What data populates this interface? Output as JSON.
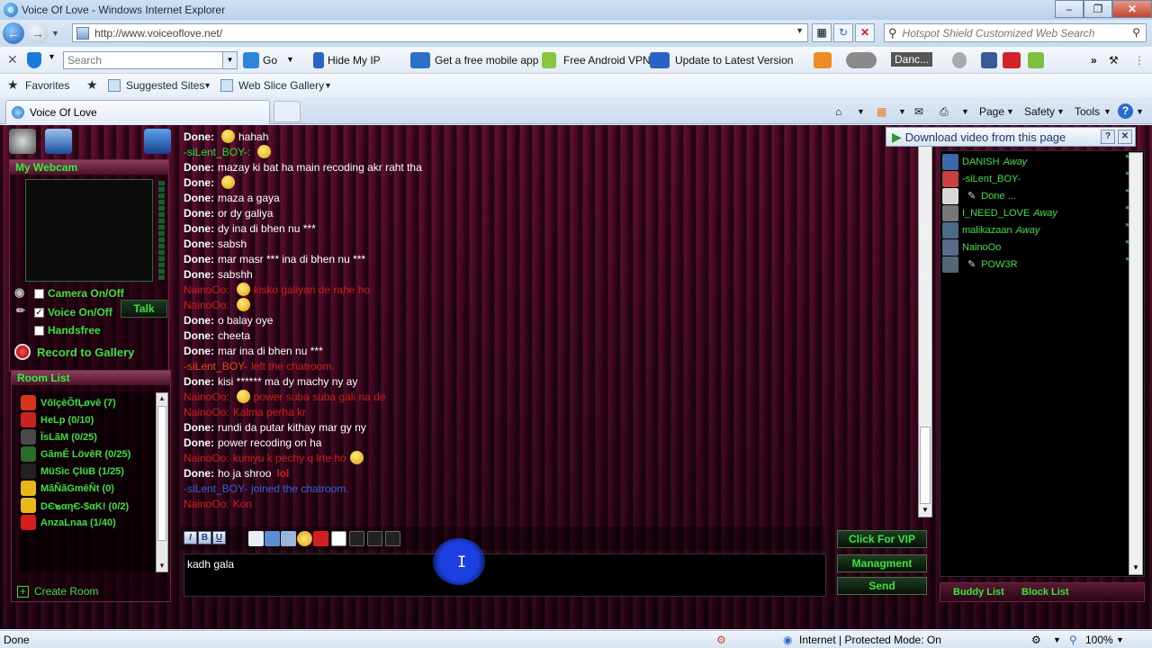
{
  "browser": {
    "title": "Voice Of Love - Windows Internet Explorer",
    "url": "http://www.voiceoflove.net/",
    "search_placeholder": "Hotspot Shield Customized Web Search",
    "tab_title": "Voice Of Love",
    "status_left": "Done",
    "status_zone": "Internet | Protected Mode: On",
    "zoom": "100%"
  },
  "toolbar": {
    "search_placeholder": "Search",
    "go": "Go",
    "hide_ip": "Hide My IP",
    "mobile_app": "Get a free mobile app",
    "android_vpn": "Free Android VPN",
    "update": "Update to Latest Version",
    "media": "Danc..."
  },
  "favorites": {
    "favorites": "Favorites",
    "suggested": "Suggested Sites",
    "web_slice": "Web Slice Gallery"
  },
  "commands": {
    "page": "Page",
    "safety": "Safety",
    "tools": "Tools"
  },
  "left_panel": {
    "webcam_title": "My Webcam",
    "camera": "Camera On/Off",
    "voice": "Voice On/Off",
    "handsfree": "Handsfree",
    "talk": "Talk",
    "record": "Record to Gallery",
    "room_list_title": "Room List",
    "create_room": "Create Room",
    "rooms": [
      {
        "name": "VôïçèÕfĻøvê (7)",
        "color": "#d9341e"
      },
      {
        "name": "HeLp (0/10)",
        "color": "#c92222"
      },
      {
        "name": "ÏsLãM (0/25)",
        "color": "#4a4a4a"
      },
      {
        "name": "GãmÉ LövêR (0/25)",
        "color": "#2a6d2a"
      },
      {
        "name": "MüSìc ÇlüB (1/25)",
        "color": "#222222"
      },
      {
        "name": "MãÑãGmêÑt (0)",
        "color": "#e8b81a"
      },
      {
        "name": "DЄ๒αηЄ-$αK! (0/2)",
        "color": "#e8b81a"
      },
      {
        "name": "AnzaLnaa (1/40)",
        "color": "#d41f1f"
      }
    ]
  },
  "chat": {
    "messages": [
      {
        "user": "Done:",
        "type": "done",
        "text": "hahah",
        "emote": true
      },
      {
        "user": "-siLent_BOY-:",
        "type": "green",
        "text": "",
        "emote": true
      },
      {
        "user": "Done:",
        "type": "done",
        "text": "mazay ki bat ha main recoding akr raht tha"
      },
      {
        "user": "Done:",
        "type": "done",
        "text": "",
        "emote": true
      },
      {
        "user": "Done:",
        "type": "done",
        "text": "maza a gaya"
      },
      {
        "user": "Done:",
        "type": "done",
        "text": "or dy galiya"
      },
      {
        "user": "Done:",
        "type": "done",
        "text": "dy ina di bhen nu ***"
      },
      {
        "user": "Done:",
        "type": "done",
        "text": "sabsh"
      },
      {
        "user": "Done:",
        "type": "done",
        "text": "mar masr *** ina di bhen nu ***"
      },
      {
        "user": "Done:",
        "type": "done",
        "text": "sabshh"
      },
      {
        "user": "NainoOo:",
        "type": "red",
        "text": "kisko galiyan de rahe ho",
        "emote": true
      },
      {
        "user": "NainoOo:",
        "type": "red",
        "text": "",
        "emote": true
      },
      {
        "user": "Done:",
        "type": "done",
        "text": "o balay oye"
      },
      {
        "user": "Done:",
        "type": "done",
        "text": "cheeta"
      },
      {
        "user": "Done:",
        "type": "done",
        "text": "mar ina di bhen nu ***"
      },
      {
        "user": "-siLent_BOY-",
        "type": "orange",
        "text": "left the chatroom."
      },
      {
        "user": "Done:",
        "type": "done",
        "text": "kisi ****** ma dy machy ny ay"
      },
      {
        "user": "NainoOo:",
        "type": "red",
        "text": "power suba suba gali na de",
        "emote": true
      },
      {
        "user": "NainoOo:",
        "type": "red",
        "text": "Kalma perha kr"
      },
      {
        "user": "Done:",
        "type": "done",
        "text": "rundi da putar kithay mar gy ny"
      },
      {
        "user": "Done:",
        "type": "done",
        "text": "power recoding on ha"
      },
      {
        "user": "NainoOo:",
        "type": "red",
        "text": "kuniyu k pechy q lrte ho",
        "emote_after": true
      },
      {
        "user": "Done:",
        "type": "done",
        "text": "ho ja shroo",
        "lol": "lol"
      },
      {
        "user": "-siLent_BOY-",
        "type": "blue",
        "text": "joined the chatroom."
      },
      {
        "user": "NainoOo:",
        "type": "red",
        "text": "Kon"
      }
    ],
    "input_value": "kadh gala",
    "vip": "Click For VIP",
    "management": "Managment",
    "send": "Send"
  },
  "right_panel": {
    "download": "Download video from this page",
    "buddies": [
      {
        "name": "DANISH",
        "status": "Away",
        "color": "#3a6aa8"
      },
      {
        "name": "-siLent_BOY-",
        "status": "",
        "color": "#c84040"
      },
      {
        "name": "Done ...",
        "status": "",
        "color": "#d8d8d8",
        "mic": true
      },
      {
        "name": "I_NEED_LOVE",
        "status": "Away",
        "color": "#777777"
      },
      {
        "name": "malikazaan",
        "status": "Away",
        "color": "#4a6a8a"
      },
      {
        "name": "NainoOo",
        "status": "",
        "color": "#5a6a8a"
      },
      {
        "name": "POW3R",
        "status": "",
        "color": "#556677",
        "mic": true
      }
    ],
    "buddy_list": "Buddy List",
    "block_list": "Block List"
  }
}
